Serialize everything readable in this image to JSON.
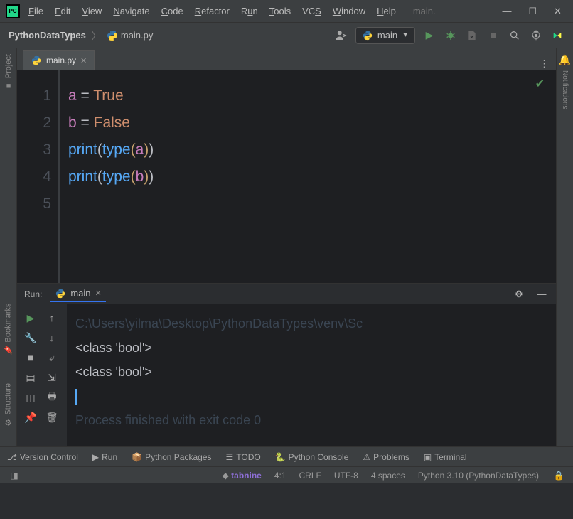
{
  "title_menu": {
    "file": "File",
    "edit": "Edit",
    "view": "View",
    "navigate": "Navigate",
    "code": "Code",
    "refactor": "Refactor",
    "run": "Run",
    "tools": "Tools",
    "vcs": "VCS",
    "window": "Window",
    "help": "Help",
    "project_short": "main."
  },
  "breadcrumb": {
    "project": "PythonDataTypes",
    "file": "main.py"
  },
  "run_config": {
    "label": "main"
  },
  "tab": {
    "file": "main.py"
  },
  "sidebar": {
    "project": "Project",
    "bookmarks": "Bookmarks",
    "structure": "Structure"
  },
  "right_rail": {
    "notifications": "Notifications"
  },
  "editor": {
    "line_numbers": [
      "1",
      "2",
      "3",
      "4",
      "5"
    ],
    "lines": [
      {
        "tokens": [
          {
            "t": "a",
            "c": "tk-name"
          },
          {
            "t": " = ",
            "c": "tk-op"
          },
          {
            "t": "True",
            "c": "tk-kw"
          }
        ]
      },
      {
        "tokens": [
          {
            "t": "b",
            "c": "tk-name"
          },
          {
            "t": " = ",
            "c": "tk-op"
          },
          {
            "t": "False",
            "c": "tk-kw"
          }
        ]
      },
      {
        "tokens": [
          {
            "t": "print",
            "c": "tk-fn"
          },
          {
            "t": "(",
            "c": "tk-paren1"
          },
          {
            "t": "type",
            "c": "tk-fn"
          },
          {
            "t": "(",
            "c": "tk-paren2"
          },
          {
            "t": "a",
            "c": "tk-name"
          },
          {
            "t": ")",
            "c": "tk-paren2"
          },
          {
            "t": ")",
            "c": "tk-paren1"
          }
        ]
      },
      {
        "tokens": [
          {
            "t": "print",
            "c": "tk-fn"
          },
          {
            "t": "(",
            "c": "tk-paren1"
          },
          {
            "t": "type",
            "c": "tk-fn"
          },
          {
            "t": "(",
            "c": "tk-paren2"
          },
          {
            "t": "b",
            "c": "tk-name"
          },
          {
            "t": ")",
            "c": "tk-paren2"
          },
          {
            "t": ")",
            "c": "tk-paren1"
          }
        ]
      },
      {
        "tokens": [
          {
            "t": "",
            "c": ""
          }
        ],
        "current": true
      }
    ]
  },
  "run_panel": {
    "label": "Run:",
    "tab": "main",
    "lines": [
      {
        "txt": "C:\\Users\\yilma\\Desktop\\PythonDataTypes\\venv\\Sc",
        "dim": true
      },
      {
        "txt": "<class 'bool'>",
        "dim": false
      },
      {
        "txt": "<class 'bool'>",
        "dim": false
      },
      {
        "cursor": true
      },
      {
        "txt": "Process finished with exit code 0",
        "dim": true
      }
    ]
  },
  "bottom_tools": {
    "vcs": "Version Control",
    "run": "Run",
    "pkg": "Python Packages",
    "todo": "TODO",
    "console": "Python Console",
    "problems": "Problems",
    "terminal": "Terminal"
  },
  "status": {
    "tabnine": "tabnine",
    "pos": "4:1",
    "eol": "CRLF",
    "enc": "UTF-8",
    "indent": "4 spaces",
    "interp": "Python 3.10 (PythonDataTypes)"
  }
}
